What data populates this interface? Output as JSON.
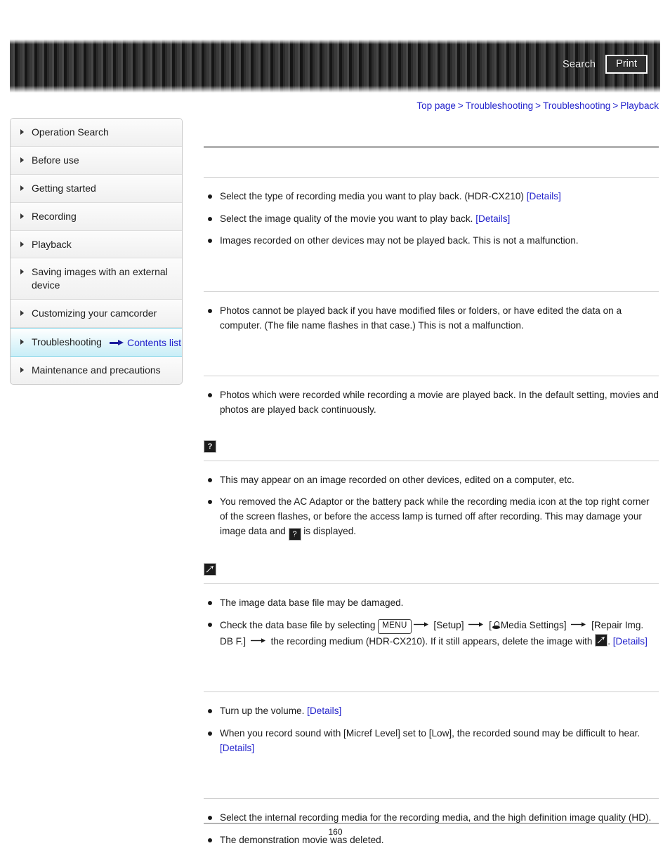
{
  "header": {
    "search_label": "Search",
    "print_label": "Print"
  },
  "breadcrumb": {
    "items": [
      "Top page",
      "Troubleshooting",
      "Troubleshooting",
      "Playback"
    ],
    "separator": ">"
  },
  "sidebar": {
    "items": [
      {
        "label": "Operation Search",
        "active": false
      },
      {
        "label": "Before use",
        "active": false
      },
      {
        "label": "Getting started",
        "active": false
      },
      {
        "label": "Recording",
        "active": false
      },
      {
        "label": "Playback",
        "active": false
      },
      {
        "label": "Saving images with an external device",
        "active": false
      },
      {
        "label": "Customizing your camcorder",
        "active": false
      },
      {
        "label": "Troubleshooting",
        "active": true
      },
      {
        "label": "Maintenance and precautions",
        "active": false
      }
    ],
    "contents_list_label": "Contents list"
  },
  "main": {
    "page_title": "",
    "sections": [
      {
        "heading": "",
        "heading_icon": "",
        "items": [
          {
            "parts": [
              {
                "type": "text",
                "text": "Select the type of recording media you want to play back. (HDR-CX210) "
              },
              {
                "type": "link",
                "text": "[Details]"
              }
            ]
          },
          {
            "parts": [
              {
                "type": "text",
                "text": "Select the image quality of the movie you want to play back. "
              },
              {
                "type": "link",
                "text": "[Details]"
              }
            ]
          },
          {
            "parts": [
              {
                "type": "text",
                "text": "Images recorded on other devices may not be played back. This is not a malfunction."
              }
            ]
          }
        ]
      },
      {
        "heading": "",
        "heading_icon": "",
        "items": [
          {
            "parts": [
              {
                "type": "text",
                "text": "Photos cannot be played back if you have modified files or folders, or have edited the data on a computer. (The file name flashes in that case.) This is not a malfunction."
              }
            ]
          }
        ]
      },
      {
        "heading": "",
        "heading_icon": "",
        "items": [
          {
            "parts": [
              {
                "type": "text",
                "text": "Photos which were recorded while recording a movie are played back. In the default setting, movies and photos are played back continuously."
              }
            ]
          }
        ]
      },
      {
        "heading": "",
        "heading_icon": "question-badge",
        "items": [
          {
            "parts": [
              {
                "type": "text",
                "text": "This may appear on an image recorded on other devices, edited on a computer, etc."
              }
            ]
          },
          {
            "parts": [
              {
                "type": "text",
                "text": "You removed the AC Adaptor or the battery pack while the recording media icon at the top right corner of the screen flashes, or before the access lamp is turned off after recording. This may damage your image data and "
              },
              {
                "type": "icon",
                "icon": "question-badge"
              },
              {
                "type": "text",
                "text": " is displayed."
              }
            ]
          }
        ]
      },
      {
        "heading": "",
        "heading_icon": "broken-image-badge",
        "items": [
          {
            "parts": [
              {
                "type": "text",
                "text": "The image data base file may be damaged."
              }
            ]
          },
          {
            "parts": [
              {
                "type": "text",
                "text": "Check the data base file by selecting "
              },
              {
                "type": "menu",
                "text": "MENU"
              },
              {
                "type": "arrow"
              },
              {
                "type": "text",
                "text": " [Setup] "
              },
              {
                "type": "arrow"
              },
              {
                "type": "text",
                "text": " ["
              },
              {
                "type": "media-glyph"
              },
              {
                "type": "text",
                "text": "Media Settings] "
              },
              {
                "type": "arrow"
              },
              {
                "type": "text",
                "text": " [Repair Img. DB F.] "
              },
              {
                "type": "arrow"
              },
              {
                "type": "text",
                "text": " the recording medium (HDR-CX210). If it still appears, delete the image with "
              },
              {
                "type": "icon",
                "icon": "broken-image-badge"
              },
              {
                "type": "text",
                "text": ". "
              },
              {
                "type": "link",
                "text": "[Details]"
              }
            ]
          }
        ]
      },
      {
        "heading": "",
        "heading_icon": "",
        "items": [
          {
            "parts": [
              {
                "type": "text",
                "text": "Turn up the volume. "
              },
              {
                "type": "link",
                "text": "[Details]"
              }
            ]
          },
          {
            "parts": [
              {
                "type": "text",
                "text": "When you record sound with [Micref Level] set to [Low], the recorded sound may be difficult to hear. "
              },
              {
                "type": "link",
                "text": "[Details]"
              }
            ]
          }
        ]
      },
      {
        "heading": "",
        "heading_icon": "",
        "items": [
          {
            "parts": [
              {
                "type": "text",
                "text": "Select the internal recording media for the recording media, and the high definition image quality (HD)."
              }
            ]
          },
          {
            "parts": [
              {
                "type": "text",
                "text": "The demonstration movie was deleted."
              }
            ]
          }
        ]
      }
    ]
  },
  "footer": {
    "page_number": "160"
  },
  "colors": {
    "link": "#2222cc",
    "active_sidebar": "#c9eef7",
    "rule": "#b3b3b3"
  }
}
